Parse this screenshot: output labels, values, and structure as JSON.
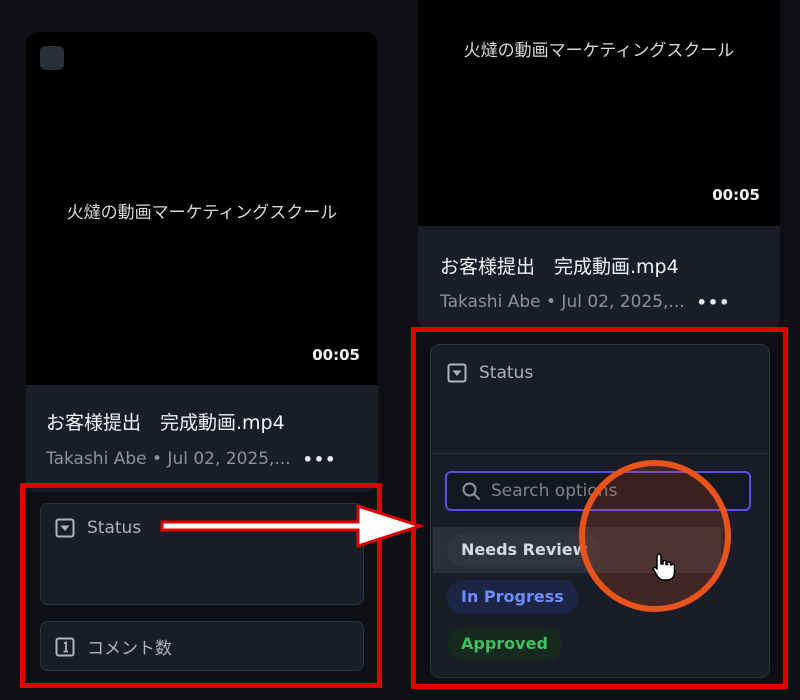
{
  "left_card": {
    "video_title": "火燵の動画マーケティングスクール",
    "duration": "00:05",
    "file_name": "お客様提出　完成動画.mp4",
    "meta": "Takashi Abe • Jul 02, 2025,...",
    "more_icon": "more-dots-icon",
    "status_label": "Status",
    "status_icon": "dropdown-square-icon",
    "comment_label": "コメント数",
    "comment_icon": "number-square-icon"
  },
  "right_card": {
    "video_title": "火燵の動画マーケティングスクール",
    "duration": "00:05",
    "file_name": "お客様提出　完成動画.mp4",
    "meta": "Takashi Abe • Jul 02, 2025,...",
    "more_icon": "more-dots-icon"
  },
  "dropdown": {
    "status_label": "Status",
    "search_placeholder": "Search options",
    "options": [
      {
        "label": "Needs Review",
        "color": "#d7d9de",
        "bg": "#2b2f3a"
      },
      {
        "label": "In Progress",
        "color": "#6f8cff",
        "bg": "#1c2545"
      },
      {
        "label": "Approved",
        "color": "#3fbf5e",
        "bg": "#16291e"
      }
    ]
  },
  "colors": {
    "highlight_box": "#e00000",
    "search_border": "#5b4ee6",
    "cursor_ring": "#e8531b",
    "arrow": "#ffffff"
  }
}
